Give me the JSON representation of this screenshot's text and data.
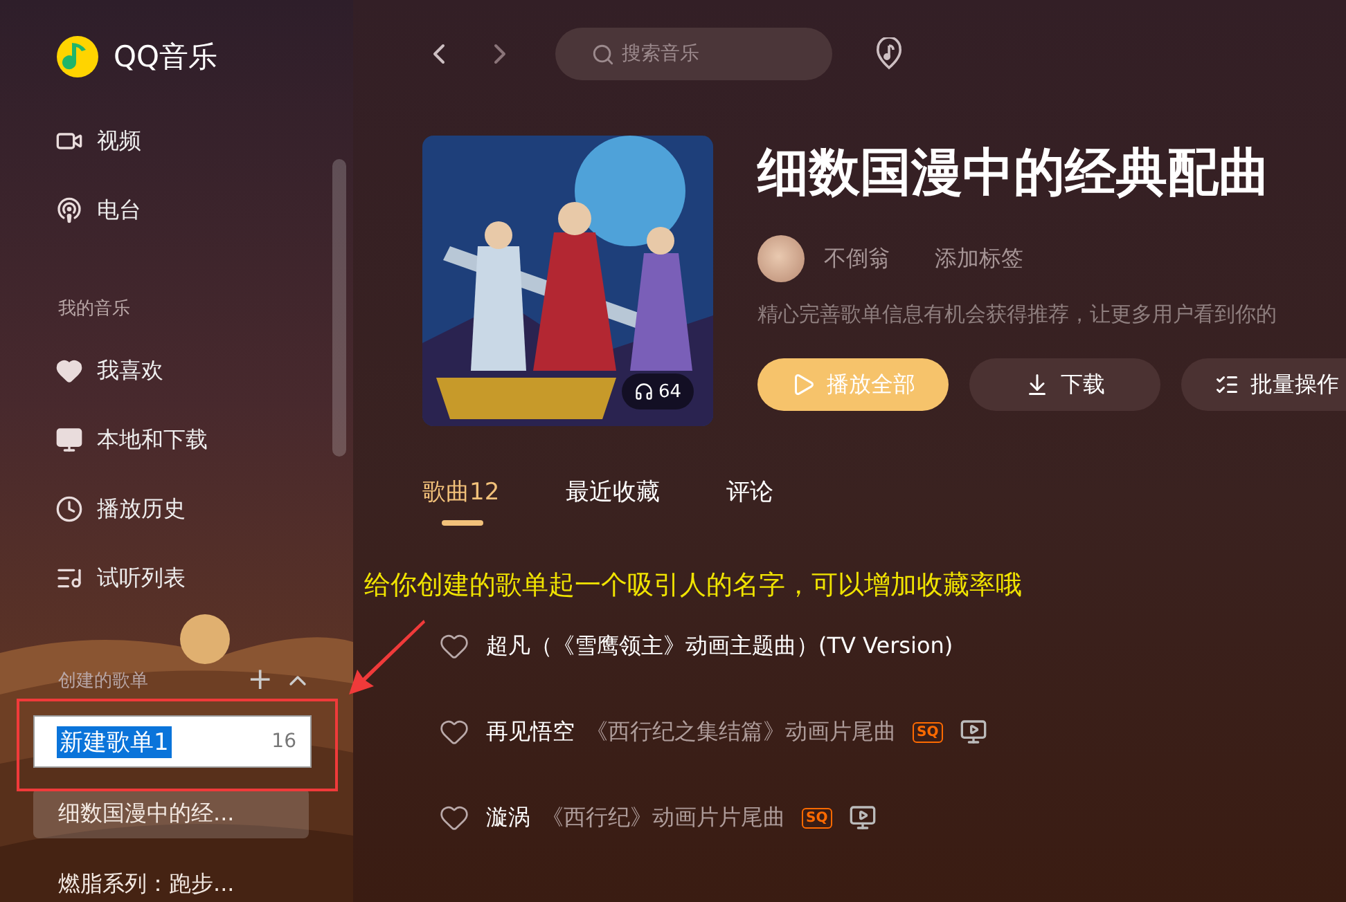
{
  "app": {
    "name": "QQ音乐"
  },
  "sidebar": {
    "nav": [
      {
        "label": "视频",
        "selected": false
      },
      {
        "label": "电台",
        "selected": false
      }
    ],
    "my_music": {
      "heading": "我的音乐",
      "items": [
        {
          "label": "我喜欢",
          "selected": false
        },
        {
          "label": "本地和下载",
          "selected": false
        },
        {
          "label": "播放历史",
          "selected": false
        },
        {
          "label": "试听列表",
          "selected": false
        }
      ]
    },
    "created": {
      "heading": "创建的歌单",
      "add": "+",
      "editing": {
        "value": "新建歌单1",
        "text_selected": true,
        "count": "16"
      },
      "playlists": [
        {
          "label": "细数国漫中的经...",
          "selected": true
        },
        {
          "label": "燃脂系列：跑步...",
          "selected": false
        }
      ]
    }
  },
  "toolbar": {
    "search": {
      "placeholder": "搜索音乐"
    }
  },
  "playlist": {
    "title": "细数国漫中的经典配曲",
    "play_count": "64",
    "creator": "不倒翁",
    "add_tag": "添加标签",
    "description": "精心完善歌单信息有机会获得推荐，让更多用户看到你的",
    "buttons": [
      {
        "label": "播放全部",
        "kind": "primary"
      },
      {
        "label": "下载",
        "kind": "download"
      },
      {
        "label": "批量操作",
        "kind": "batch"
      }
    ]
  },
  "tabs": [
    {
      "label": "歌曲12",
      "selected": true
    },
    {
      "label": "最近收藏",
      "selected": false
    },
    {
      "label": "评论",
      "selected": false
    }
  ],
  "songs": {
    "rows": [
      {
        "name": "超凡（《雪鹰领主》动画主题曲）(TV Version)",
        "mv": false
      },
      {
        "name": "再见悟空",
        "subtitle": "《西行纪之集结篇》动画片尾曲",
        "sq": "SQ",
        "mv": true
      },
      {
        "name": "漩涡",
        "subtitle": "《西行纪》动画片片尾曲",
        "sq": "SQ",
        "mv": true
      }
    ]
  },
  "annotation": {
    "text": "给你创建的歌单起一个吸引人的名字，可以增加收藏率哦"
  }
}
